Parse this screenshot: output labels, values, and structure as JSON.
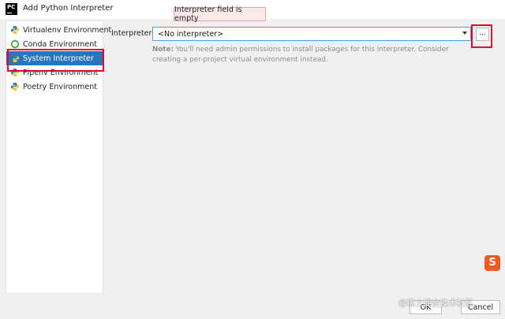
{
  "window": {
    "title": "Add Python Interpreter",
    "app_icon_text": "PC"
  },
  "sidebar": {
    "items": [
      {
        "label": "Virtualenv Environment",
        "icon": "python-icon",
        "selected": false
      },
      {
        "label": "Conda Environment",
        "icon": "conda-ring-icon",
        "selected": false
      },
      {
        "label": "System Interpreter",
        "icon": "python-icon",
        "selected": true
      },
      {
        "label": "Pipenv Environment",
        "icon": "python-icon",
        "selected": false
      },
      {
        "label": "Poetry Environment",
        "icon": "python-icon",
        "selected": false
      }
    ]
  },
  "error_tooltip": "Interpreter field is empty",
  "interpreter": {
    "label": "Interpreter:",
    "value": "<No interpreter>",
    "browse_label": "..."
  },
  "note": {
    "prefix": "Note:",
    "text": " You'll need admin permissions to install packages for this interpreter. Consider creating a per-project virtual environment instead."
  },
  "buttons": {
    "ok": "OK",
    "cancel": "Cancel"
  },
  "watermark": "@稀土掘金技术社区",
  "colors": {
    "selection": "#2675bf",
    "highlight_box": "#e4002b",
    "focus_border": "#5a9bd6",
    "error_bg": "#fce9ea"
  }
}
